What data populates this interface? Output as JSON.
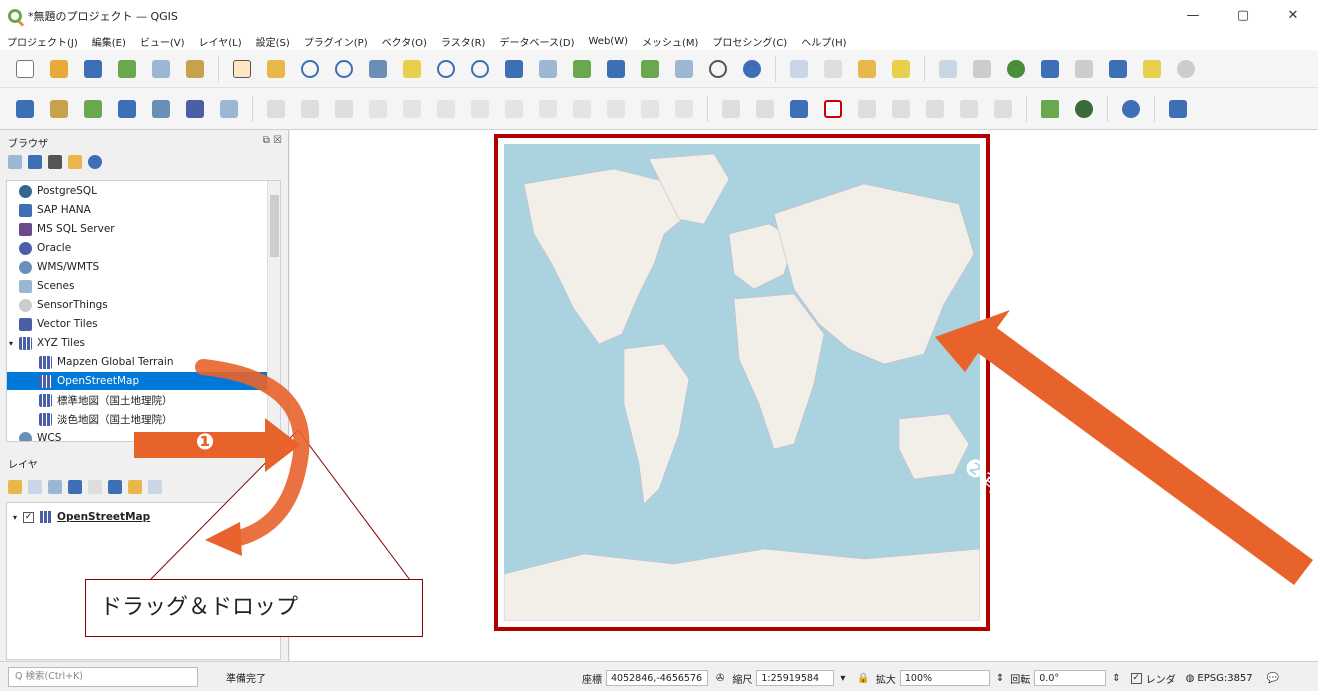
{
  "window": {
    "title": "*無題のプロジェクト — QGIS",
    "controls": [
      "—",
      "▢",
      "✕"
    ]
  },
  "menu": [
    "プロジェクト(J)",
    "編集(E)",
    "ビュー(V)",
    "レイヤ(L)",
    "設定(S)",
    "プラグイン(P)",
    "ベクタ(O)",
    "ラスタ(R)",
    "データベース(D)",
    "Web(W)",
    "メッシュ(M)",
    "プロセシング(C)",
    "ヘルプ(H)"
  ],
  "browser": {
    "title": "ブラウザ",
    "items": [
      "PostgreSQL",
      "SAP HANA",
      "MS SQL Server",
      "Oracle",
      "WMS/WMTS",
      "Scenes",
      "SensorThings",
      "Vector Tiles",
      "XYZ Tiles",
      "Mapzen Global Terrain",
      "OpenStreetMap",
      "標準地図（国土地理院）",
      "淡色地図（国土地理院）",
      "WCS"
    ],
    "selected": "OpenStreetMap"
  },
  "layers": {
    "title": "レイヤ",
    "items": [
      {
        "name": "OpenStreetMap",
        "checked": "✓"
      }
    ]
  },
  "annotations": {
    "drag_drop": "ドラッグ＆ドロップ",
    "step1": "❶",
    "step2": "❷背景地図が追加される"
  },
  "status": {
    "search_placeholder": "Q 検索(Ctrl+K)",
    "ready": "準備完了",
    "coord_label": "座標",
    "coord_value": "4052846,-4656576",
    "scale_label": "縮尺",
    "scale_value": "1:25919584",
    "magnifier_label": "拡大",
    "magnifier_value": "100%",
    "rotation_label": "回転",
    "rotation_value": "0.0°",
    "render_label": "レンダ",
    "crs": "EPSG:3857"
  },
  "colors": {
    "accent": "#e8632b",
    "frame": "#b00000",
    "water": "#aad3df",
    "land": "#f2efe9",
    "selection": "#0078d7"
  }
}
